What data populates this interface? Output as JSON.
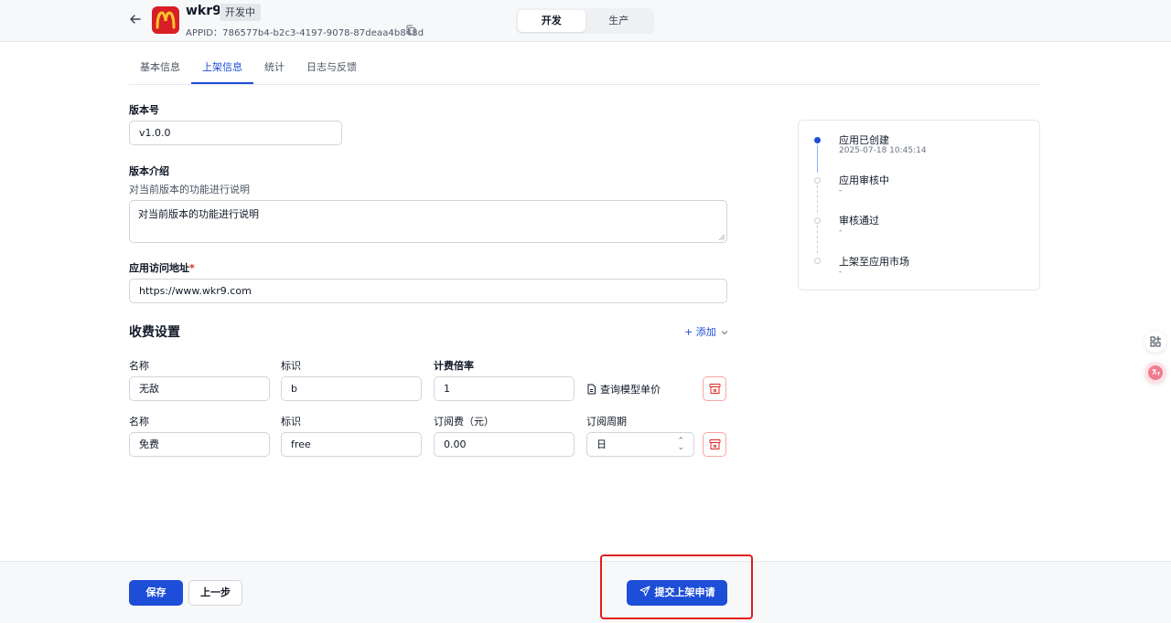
{
  "header": {
    "app_name": "wkr9",
    "status": "开发中",
    "appid": "APPID：786577b4-b2c3-4197-9078-87deaa4b848d",
    "env_tabs": [
      {
        "label": "开发",
        "active": true
      },
      {
        "label": "生产",
        "active": false
      }
    ]
  },
  "tabs": [
    {
      "label": "基本信息",
      "active": false
    },
    {
      "label": "上架信息",
      "active": true
    },
    {
      "label": "统计",
      "active": false
    },
    {
      "label": "日志与反馈",
      "active": false
    }
  ],
  "form": {
    "version_label": "版本号",
    "version_value": "v1.0.0",
    "intro_label": "版本介绍",
    "intro_hint": "对当前版本的功能进行说明",
    "intro_value": "对当前版本的功能进行说明",
    "url_label": "应用访问地址",
    "url_required_mark": "*",
    "url_value": "https://www.wkr9.com"
  },
  "billing": {
    "title": "收费设置",
    "add_label": "+ 添加",
    "rows": [
      {
        "name_label": "名称",
        "name_value": "无敌",
        "id_label": "标识",
        "id_value": "b",
        "rate_label": "计费倍率",
        "rate_value": "1",
        "query_label": "查询模型单价"
      },
      {
        "name_label": "名称",
        "name_value": "免费",
        "id_label": "标识",
        "id_value": "free",
        "fee_label": "订阅费（元）",
        "fee_value": "0.00",
        "period_label": "订阅周期",
        "period_value": "日"
      }
    ]
  },
  "timeline": [
    {
      "title": "应用已创建",
      "sub": "2025-07-18 10:45:14",
      "done": true
    },
    {
      "title": "应用审核中",
      "sub": "-",
      "done": false
    },
    {
      "title": "审核通过",
      "sub": "-",
      "done": false
    },
    {
      "title": "上架至应用市场",
      "sub": "-",
      "done": false
    }
  ],
  "footer": {
    "save_label": "保存",
    "prev_label": "上一步",
    "submit_label": "提交上架申请"
  },
  "colors": {
    "primary": "#1d4ed8",
    "danger": "#dc2626",
    "logo_bg": "#d91f26",
    "logo_fg": "#ffc72c"
  },
  "icons": {
    "back": "arrow-left-icon",
    "copy": "copy-icon",
    "chevron": "chevron-down-icon",
    "doc": "document-icon",
    "delete": "archive-delete-icon",
    "send": "send-icon"
  }
}
